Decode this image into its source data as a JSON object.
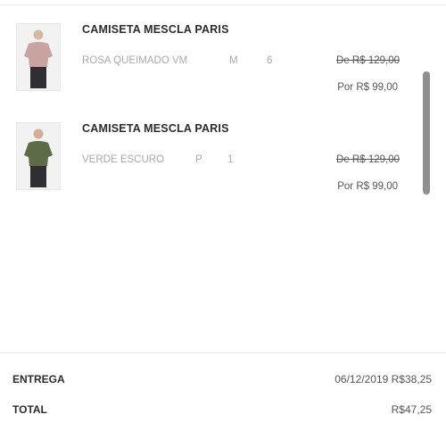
{
  "cart": {
    "items": [
      {
        "name": "CAMISETA MESCLA PARIS",
        "variant": "ROSA QUEIMADO VM",
        "size": "M",
        "quantity": "6",
        "old_price": "De R$ 129,00",
        "new_price": "Por  R$ 99,00",
        "shirt_color": "#c9a3a0"
      },
      {
        "name": "CAMISETA MESCLA PARIS",
        "variant": "VERDE ESCURO",
        "size": "P",
        "quantity": "1",
        "old_price": "De R$ 129,00",
        "new_price": "Por  R$ 99,00",
        "shirt_color": "#5d6b49"
      }
    ]
  },
  "summary": {
    "delivery_label": "ENTREGA",
    "delivery_value": "06/12/2019 R$38,25",
    "total_label": "TOTAL",
    "total_value": "R$47,25"
  }
}
